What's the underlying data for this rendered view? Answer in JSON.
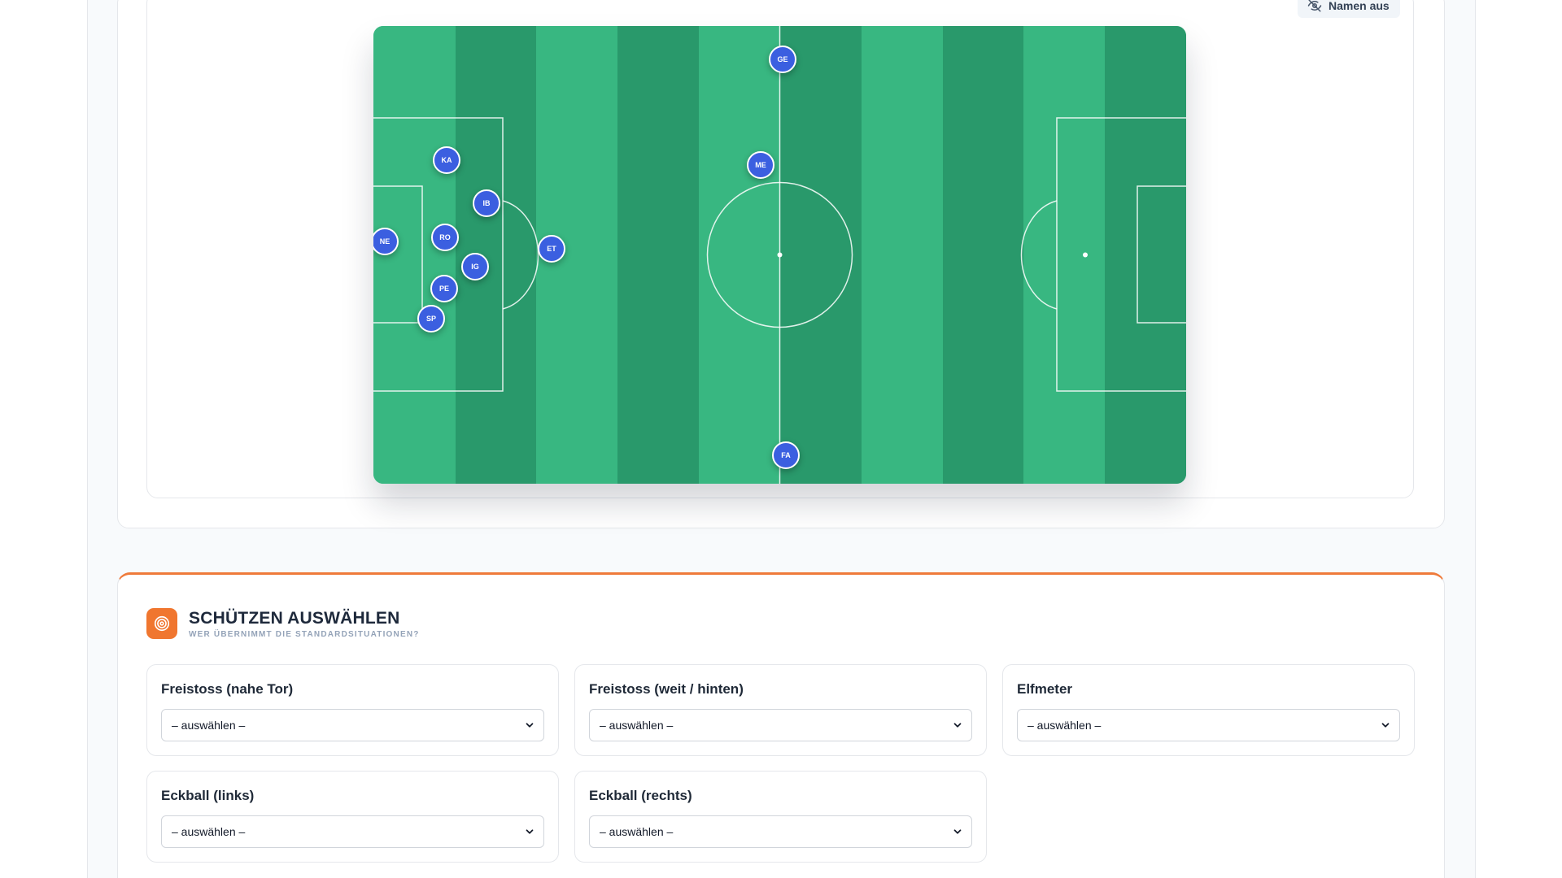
{
  "toolbar": {
    "names_toggle_label": "Namen aus",
    "names_toggle_icon": "eye-off-icon"
  },
  "pitch": {
    "colors": {
      "light": "#38b781",
      "dark": "#29996b",
      "lines": "#ffffff",
      "player": "#3b5fe0"
    },
    "players": [
      {
        "initials": "GE"
      },
      {
        "initials": "ME"
      },
      {
        "initials": "KA"
      },
      {
        "initials": "IB"
      },
      {
        "initials": "NE"
      },
      {
        "initials": "RO"
      },
      {
        "initials": "ET"
      },
      {
        "initials": "IG"
      },
      {
        "initials": "PE"
      },
      {
        "initials": "SP"
      },
      {
        "initials": "FA"
      }
    ]
  },
  "set_pieces": {
    "title": "SCHÜTZEN AUSWÄHLEN",
    "subtitle": "WER ÜBERNIMMT DIE STANDARDSITUATIONEN?",
    "icon": "target-icon",
    "accent": "#f0762f",
    "fields": [
      {
        "label": "Freistoss (nahe Tor)",
        "value": "– auswählen –"
      },
      {
        "label": "Freistoss (weit / hinten)",
        "value": "– auswählen –"
      },
      {
        "label": "Elfmeter",
        "value": "– auswählen –"
      },
      {
        "label": "Eckball (links)",
        "value": "– auswählen –"
      },
      {
        "label": "Eckball (rechts)",
        "value": "– auswählen –"
      }
    ]
  }
}
